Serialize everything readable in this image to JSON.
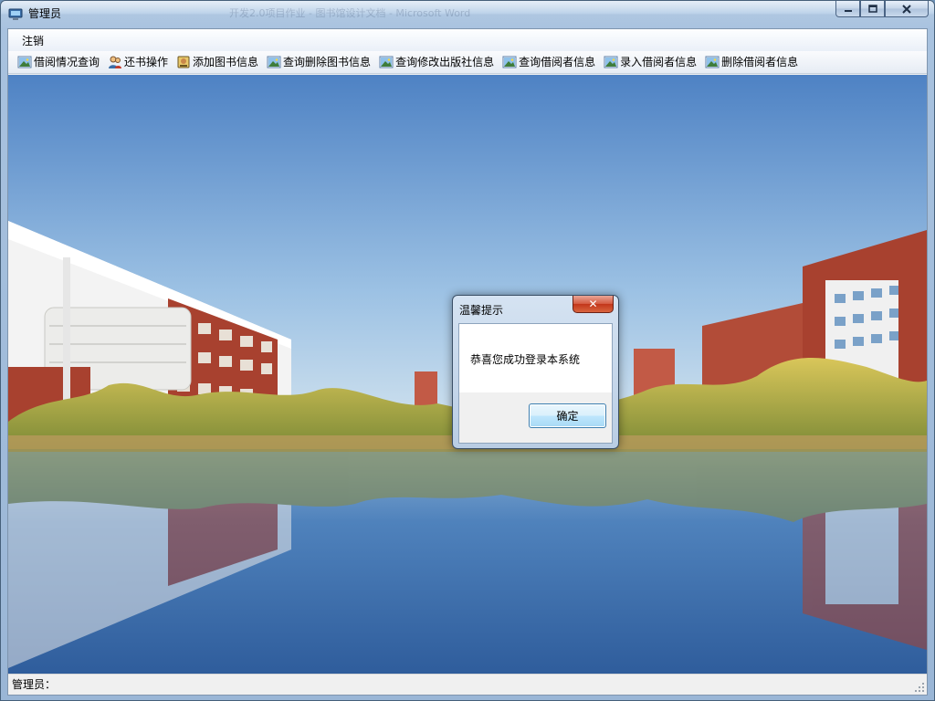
{
  "window": {
    "title": "管理员",
    "background_title_ghost": "开发2.0项目作业 - 图书馆设计文档 - Microsoft Word"
  },
  "menu": {
    "items": [
      "注销"
    ]
  },
  "toolbar": {
    "items": [
      {
        "label": "借阅情况查询",
        "icon": "picture-icon"
      },
      {
        "label": "还书操作",
        "icon": "users-icon"
      },
      {
        "label": "添加图书信息",
        "icon": "add-book-icon"
      },
      {
        "label": "查询删除图书信息",
        "icon": "picture-icon"
      },
      {
        "label": "查询修改出版社信息",
        "icon": "picture-icon"
      },
      {
        "label": "查询借阅者信息",
        "icon": "picture-icon"
      },
      {
        "label": "录入借阅者信息",
        "icon": "picture-icon"
      },
      {
        "label": "删除借阅者信息",
        "icon": "picture-icon"
      }
    ]
  },
  "status": {
    "text": "管理员："
  },
  "dialog": {
    "title": "温馨提示",
    "message": "恭喜您成功登录本系统",
    "ok_label": "确定",
    "close_glyph": "✕"
  },
  "colors": {
    "sky_top": "#4e82c4",
    "sky_bottom": "#c8ddee",
    "water": "#3d6fae",
    "brick": "#a8412f",
    "trees": "#c8b24a"
  }
}
